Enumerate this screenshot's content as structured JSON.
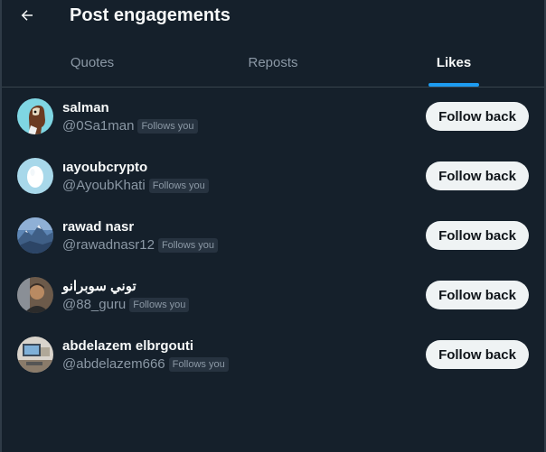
{
  "header": {
    "title": "Post engagements",
    "back_icon": "arrow-left-icon"
  },
  "tabs": [
    {
      "label": "Quotes",
      "active": false
    },
    {
      "label": "Reposts",
      "active": false
    },
    {
      "label": "Likes",
      "active": true
    }
  ],
  "colors": {
    "background": "#15202b",
    "accent": "#1d9bf0",
    "text_primary": "#f7f9f9",
    "text_secondary": "#8b98a5",
    "button_bg": "#eff3f4"
  },
  "users": [
    {
      "name": "salman",
      "handle": "@0Sa1man",
      "badge": "Follows you",
      "button": "Follow back"
    },
    {
      "name": "ıayoubcrypto",
      "handle": "@AyoubKhati",
      "badge": "Follows you",
      "button": "Follow back"
    },
    {
      "name": "rawad nasr",
      "handle": "@rawadnasr12",
      "badge": "Follows you",
      "button": "Follow back"
    },
    {
      "name": "توني سوبرانو",
      "handle": "@88_guru",
      "badge": "Follows you",
      "button": "Follow back"
    },
    {
      "name": "abdelazem elbrgouti",
      "handle": "@abdelazem666",
      "badge": "Follows you",
      "button": "Follow back"
    }
  ]
}
